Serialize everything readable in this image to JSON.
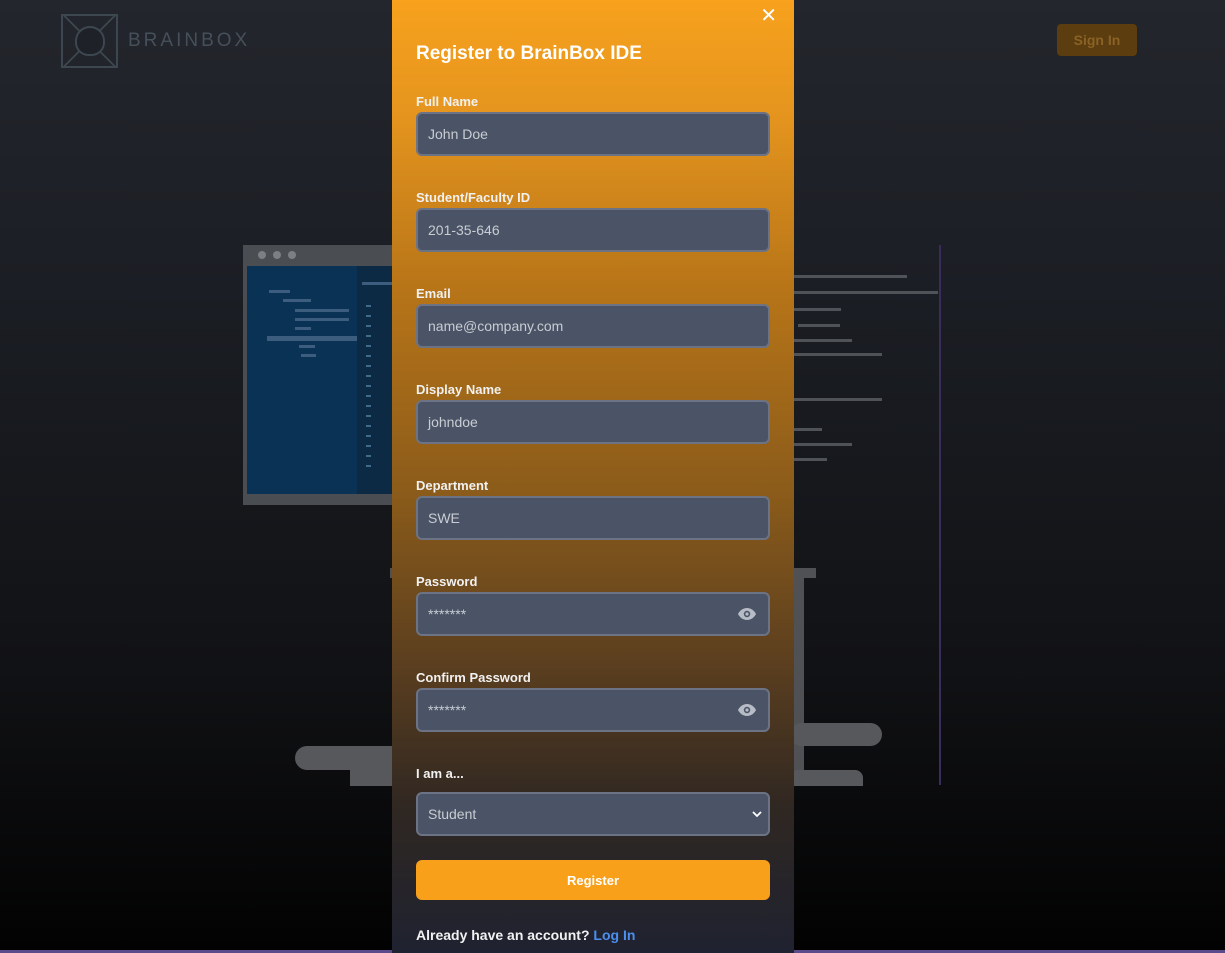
{
  "header": {
    "brand": "BRAINBOX",
    "sign_in_label": "Sign In"
  },
  "modal": {
    "title": "Register to BrainBox IDE",
    "close_glyph": "✕",
    "fields": {
      "full_name": {
        "label": "Full Name",
        "placeholder": "John Doe"
      },
      "student_id": {
        "label": "Student/Faculty ID",
        "placeholder": "201-35-646"
      },
      "email": {
        "label": "Email",
        "placeholder": "name@company.com"
      },
      "display_name": {
        "label": "Display Name",
        "placeholder": "johndoe"
      },
      "department": {
        "label": "Department",
        "placeholder": "SWE"
      },
      "password": {
        "label": "Password",
        "placeholder": "*******"
      },
      "confirm_password": {
        "label": "Confirm Password",
        "placeholder": "*******"
      },
      "role": {
        "label": "I am a...",
        "selected": "Student"
      }
    },
    "register_label": "Register",
    "footer_prefix": "Already have an account?",
    "footer_link": "Log In"
  },
  "icons": {
    "close": "close-icon",
    "eye": "eye-icon",
    "chevron": "chevron-down-icon",
    "logo": "brain-logo-icon"
  },
  "colors": {
    "accent": "#f9a01b",
    "link": "#4a8ff0",
    "input_bg": "#4a5466"
  }
}
